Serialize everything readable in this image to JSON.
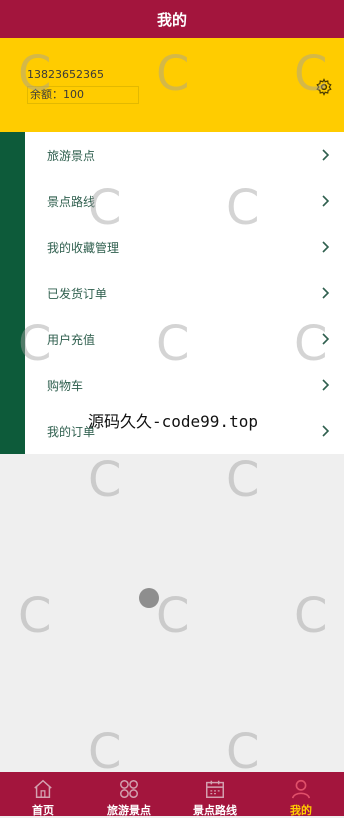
{
  "header": {
    "title": "我的"
  },
  "profile": {
    "phone": "13823652365",
    "balance_label": "余额：",
    "balance_value": "100",
    "settings_icon": "gear-icon"
  },
  "menu": {
    "items": [
      {
        "label": "旅游景点"
      },
      {
        "label": "景点路线"
      },
      {
        "label": "我的收藏管理"
      },
      {
        "label": "已发货订单"
      },
      {
        "label": "用户充值"
      },
      {
        "label": "购物车"
      },
      {
        "label": "我的订单"
      }
    ]
  },
  "watermark": {
    "site": "源码久久-code99.top",
    "glyph": "C"
  },
  "tabs": [
    {
      "label": "首页",
      "icon": "home-icon",
      "active": false
    },
    {
      "label": "旅游景点",
      "icon": "grid-icon",
      "active": false
    },
    {
      "label": "景点路线",
      "icon": "calendar-icon",
      "active": false
    },
    {
      "label": "我的",
      "icon": "user-icon",
      "active": true
    }
  ],
  "colors": {
    "header": "#a3153d",
    "profile": "#ffcc00",
    "menu_bar": "#0d5b3a",
    "tab_active": "#ffcc00"
  }
}
